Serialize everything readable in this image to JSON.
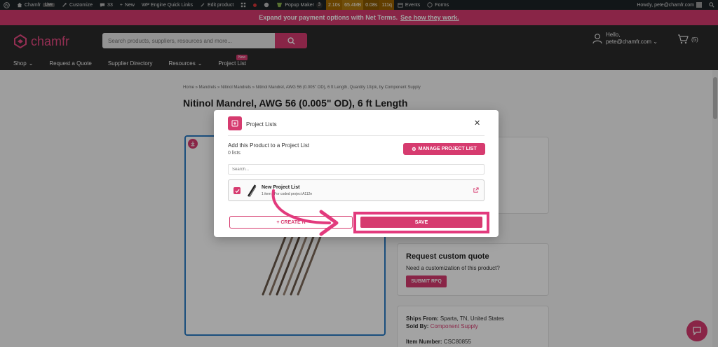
{
  "admin_bar": {
    "site_name": "Chamfr",
    "live_label": "Live",
    "customize": "Customize",
    "comments_count": "33",
    "new": "New",
    "wp_engine": "WP Engine Quick Links",
    "edit_product": "Edit product",
    "popup_maker": "Popup Maker",
    "popup_count": "3",
    "perf": [
      "2.10s",
      "65.4MB",
      "0.08s",
      "111q"
    ],
    "events": "Events",
    "forms": "Forms",
    "howdy": "Howdy, pete@chamfr.com"
  },
  "promo": {
    "text": "Expand your payment options with Net Terms.",
    "link": "See how they work."
  },
  "header": {
    "logo_text": "chamfr",
    "search_placeholder": "Search products, suppliers, resources and more...",
    "account_hello": "Hello,",
    "account_email": "pete@chamfr.com",
    "cart_count": "(5)",
    "nav": {
      "shop": "Shop",
      "request_quote": "Request a Quote",
      "supplier_directory": "Supplier Directory",
      "resources": "Resources",
      "project_list": "Project List",
      "new_badge": "New"
    },
    "colors": {
      "brand": "#d63b6f",
      "header_bg": "#2b2b2b"
    }
  },
  "product": {
    "breadcrumb": "Home » Mandrels » Nitinol Mandrels » Nitinol Mandrel, AWG 56 (0.005\" OD), 6 ft Length, Quantity 10/pk, by Component Supply",
    "title": "Nitinol Mandrel, AWG 56 (0.005\" OD), 6 ft Length"
  },
  "quote_card": {
    "title": "Request custom quote",
    "subtitle": "Need a customization of this product?",
    "button": "SUBMIT RFQ"
  },
  "shipping": {
    "ships_from_label": "Ships From:",
    "ships_from_value": "Sparta, TN, United States",
    "sold_by_label": "Sold By:",
    "sold_by_value": "Component Supply",
    "item_number_label": "Item Number:",
    "item_number_value": "CSC80855"
  },
  "modal": {
    "title": "Project Lists",
    "subtitle": "Add this Product to a Project List",
    "count": "0 lists",
    "manage_button": "MANAGE PROJECT LIST",
    "search_placeholder": "Search...",
    "lists": [
      {
        "name": "New Project List",
        "meta_prefix": "1 item",
        "meta_suffix": "For coded project A112e",
        "checked": true
      }
    ],
    "create_button": "+ CREATE N",
    "save_button": "SAVE"
  }
}
